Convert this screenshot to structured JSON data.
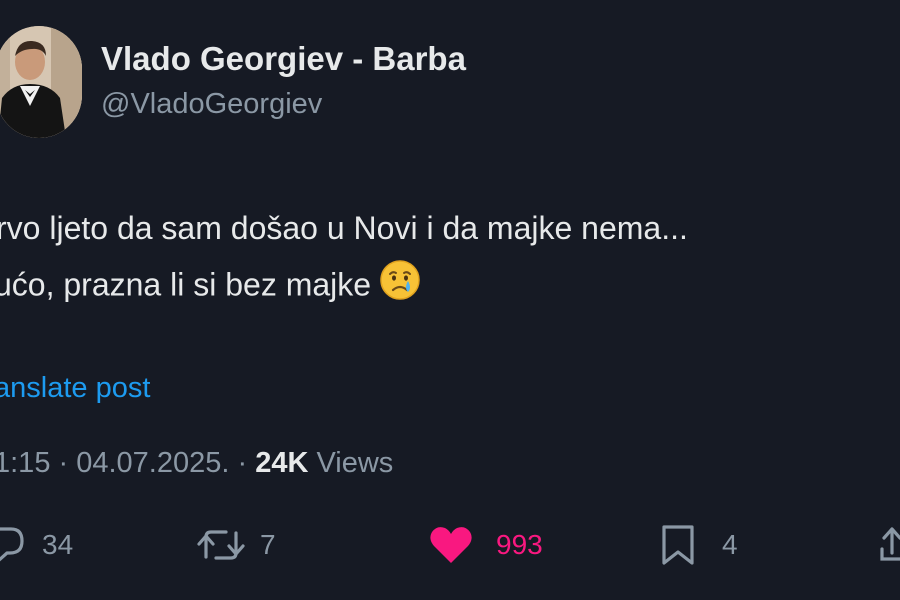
{
  "author": {
    "name": "Vlado Georgiev - Barba",
    "handle": "@VladoGeorgiev",
    "avatar_icon": "profile-photo"
  },
  "tweet": {
    "line1": "rvo ljeto da sam došao u Novi i da majke nema...",
    "line2": "ućo, prazna li si bez majke",
    "emoji": "crying-face"
  },
  "translate_label": "anslate post",
  "meta": {
    "time": "1:15",
    "separator1": " · ",
    "date": "04.07.2025.",
    "separator2": " · ",
    "views_count": "24K",
    "views_label": " Views"
  },
  "actions": {
    "replies": "34",
    "reposts": "7",
    "likes": "993",
    "bookmarks": "4"
  },
  "colors": {
    "background": "#161a24",
    "text": "#e7e9ea",
    "secondary": "#8b98a5",
    "link": "#1d9bf0",
    "like": "#f91880"
  }
}
